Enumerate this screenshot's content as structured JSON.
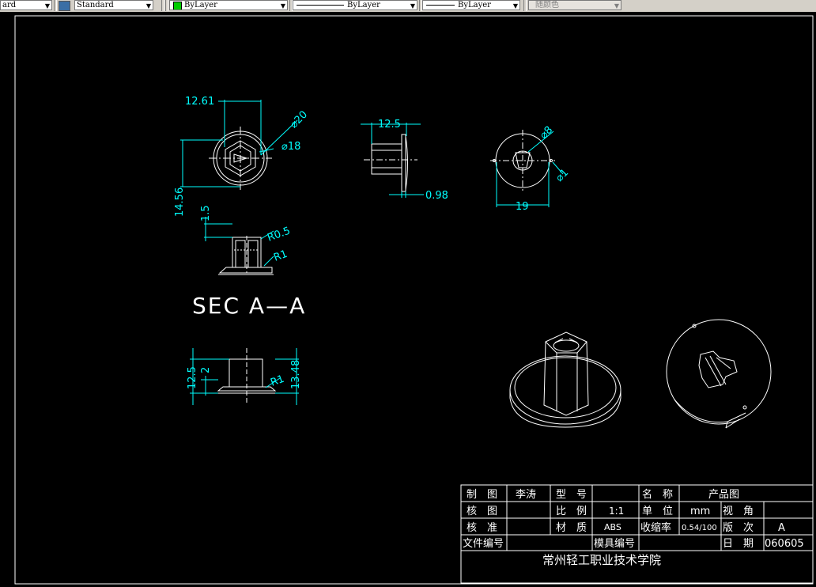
{
  "toolbar": {
    "text_style": "ard",
    "dim_style": "Standard",
    "layer": "ByLayer",
    "linetype": "ByLayer",
    "lineweight": "ByLayer",
    "plot_style": "随颜色",
    "layer_color": "#00cc00"
  },
  "drawing": {
    "section_label": "SEC A—A",
    "dims": {
      "d_12_61": "12.61",
      "d_phi20": "⌀20",
      "d_phi18": "⌀18",
      "d_14_56": "14.56",
      "d_1_5": "1.5",
      "d_r0_5": "R0.5",
      "d_r1_a": "R1",
      "d_12_5_top": "12.5",
      "d_0_98": "0.98",
      "d_phi8": "⌀8",
      "d_phi1": "⌀1",
      "d_19": "19",
      "d_12_5_side": "12.5",
      "d_2": "2",
      "d_r1_b": "R1",
      "d_13_48": "13.48"
    }
  },
  "title_block": {
    "r1": [
      "制　图",
      "李涛",
      "型　号",
      "",
      "名　称",
      "产品图"
    ],
    "r2": [
      "核　图",
      "",
      "比　例",
      "1:1",
      "单　位",
      "mm",
      "视　角",
      ""
    ],
    "r3": [
      "核　准",
      "",
      "材　质",
      "ABS",
      "收缩率",
      "0.54/100",
      "版　次",
      "A"
    ],
    "r4": [
      "文件编号",
      "",
      "模具编号",
      "",
      "日　期",
      "060605"
    ],
    "school": "常州轻工职业技术学院"
  },
  "colors": {
    "line": "#ffffff",
    "dim": "#00ffff"
  }
}
